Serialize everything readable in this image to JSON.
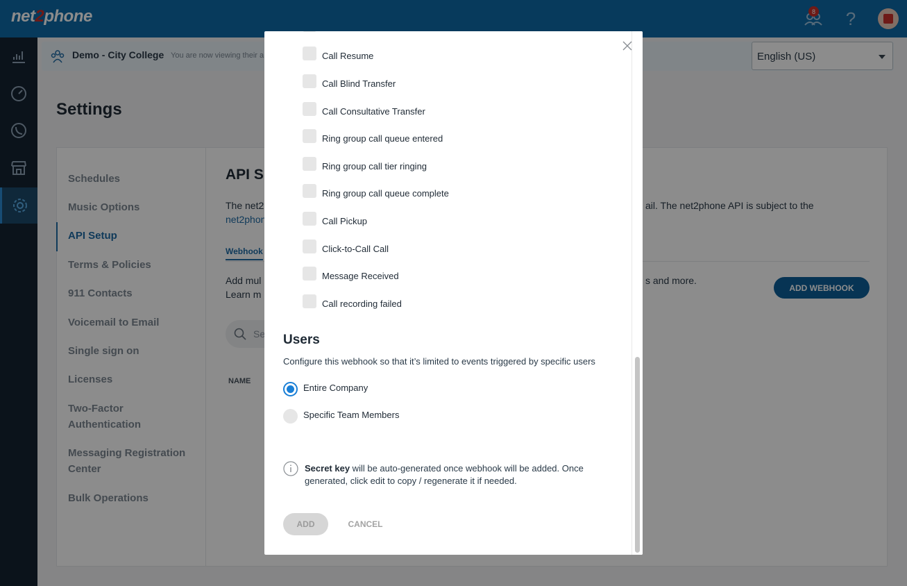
{
  "topbar": {
    "logo_part1": "net",
    "logo_part2": "2",
    "logo_part3": "phone",
    "notification_count": "8",
    "help_label": "?"
  },
  "context": {
    "company": "Demo - City College",
    "subtitle": "You are now viewing their a",
    "language": "English (US)"
  },
  "page": {
    "title": "Settings"
  },
  "settings_menu": {
    "items": [
      "Schedules",
      "Music Options",
      "API Setup",
      "Terms & Policies",
      "911 Contacts",
      "Voicemail to Email",
      "Single sign on",
      "Licenses",
      "Two-Factor Authentication",
      "Messaging Registration Center",
      "Bulk Operations"
    ],
    "active": "API Setup"
  },
  "api_section": {
    "title": "API S",
    "desc_left": "The net2",
    "desc_right": "ail. The net2phone API is subject to the",
    "link": "net2phon",
    "tab": "Webhook",
    "add_desc_left1": "Add mul",
    "add_desc_left2": "Learn m",
    "add_desc_right": "s and more.",
    "add_button": "ADD WEBHOOK",
    "search_placeholder": "Se",
    "name_column": "NAME"
  },
  "modal": {
    "events": [
      "Call Resume",
      "Call Blind Transfer",
      "Call Consultative Transfer",
      "Ring group call queue entered",
      "Ring group call tier ringing",
      "Ring group call queue complete",
      "Call Pickup",
      "Click-to-Call Call",
      "Message Received",
      "Call recording failed"
    ],
    "users_title": "Users",
    "users_desc": "Configure this webhook so that it’s limited to events triggered by specific users",
    "options": [
      {
        "label": "Entire Company",
        "checked": true
      },
      {
        "label": "Specific Team Members",
        "checked": false
      }
    ],
    "secret_key_bold": "Secret key",
    "secret_key_text": " will be auto-generated once webhook will be added. Once generated, click edit to copy / regenerate it if needed.",
    "add_button": "ADD",
    "cancel_button": "CANCEL"
  },
  "colors": {
    "topbar": "#0e6aa8",
    "nav": "#152432",
    "accent": "#1e6ba5",
    "radio_selected": "#1a7fd6"
  }
}
